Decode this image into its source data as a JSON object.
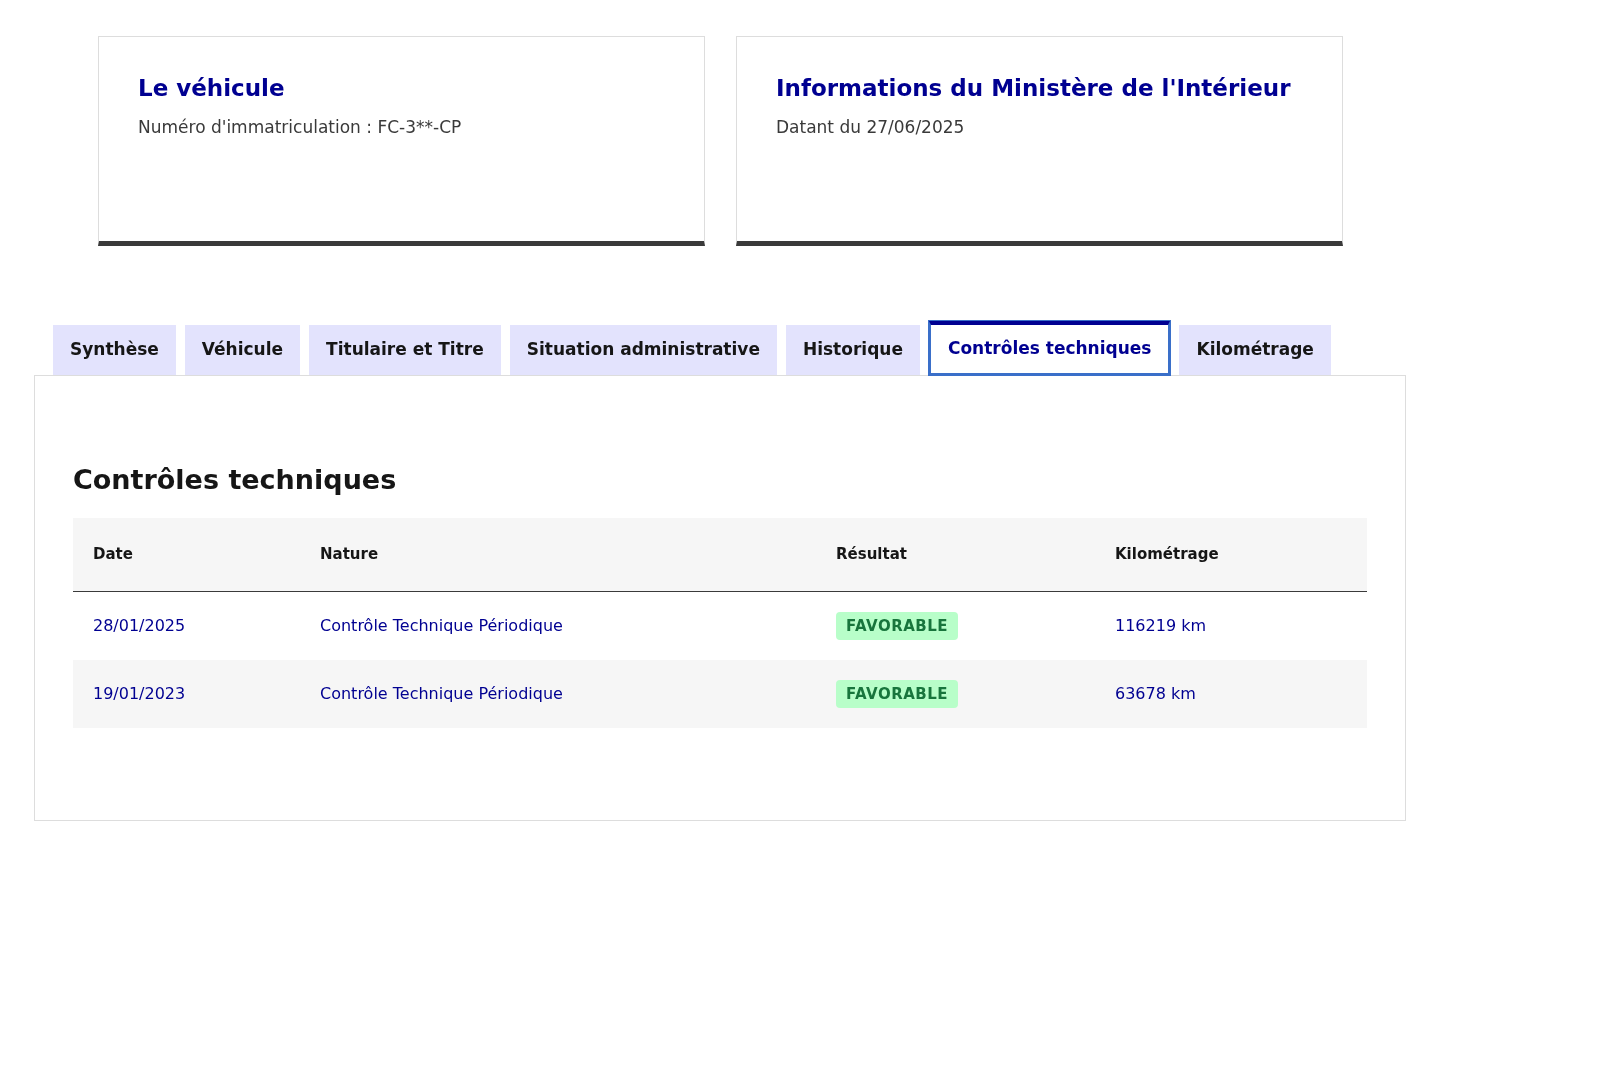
{
  "cards": [
    {
      "title": "Le véhicule",
      "subtitle": "Numéro d'immatriculation : FC-3**-CP"
    },
    {
      "title": "Informations du Ministère de l'Intérieur",
      "subtitle": "Datant du 27/06/2025"
    }
  ],
  "tabs": [
    {
      "label": "Synthèse",
      "selected": false
    },
    {
      "label": "Véhicule",
      "selected": false
    },
    {
      "label": "Titulaire et Titre",
      "selected": false
    },
    {
      "label": "Situation administrative",
      "selected": false
    },
    {
      "label": "Historique",
      "selected": false
    },
    {
      "label": "Contrôles techniques",
      "selected": true
    },
    {
      "label": "Kilométrage",
      "selected": false
    }
  ],
  "panel": {
    "heading": "Contrôles techniques",
    "table": {
      "columns": [
        "Date",
        "Nature",
        "Résultat",
        "Kilométrage"
      ],
      "rows": [
        {
          "date": "28/01/2025",
          "nature": "Contrôle Technique Périodique",
          "result": "FAVORABLE",
          "mileage": "116219 km"
        },
        {
          "date": "19/01/2023",
          "nature": "Contrôle Technique Périodique",
          "result": "FAVORABLE",
          "mileage": "63678 km"
        }
      ]
    }
  }
}
